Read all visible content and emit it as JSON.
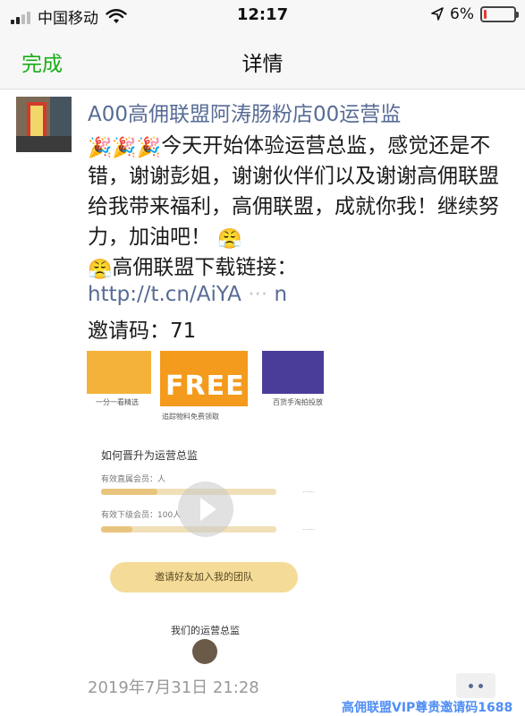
{
  "status_bar": {
    "carrier": "中国移动",
    "time": "12:17",
    "battery_percent": "6%",
    "battery_level": 0.06,
    "icons": [
      "signal-icon",
      "wifi-icon",
      "location-icon",
      "battery-icon"
    ]
  },
  "nav": {
    "done_label": "完成",
    "title": "详情"
  },
  "post": {
    "author": "A00高佣联盟阿涛肠粉店00运营监",
    "text_line1": "今天开始体验运营总监，感觉还是不错，谢谢彭姐，谢谢伙伴们以及谢谢高佣联盟给我带来福利，高佣联盟，成就你我！继续努力，加油吧！",
    "text_line2": "高佣联盟下载链接：",
    "emojis": [
      "party-popper",
      "party-popper",
      "party-popper",
      "strong-face",
      "strong-face"
    ],
    "link": "http://t.cn/AiYA",
    "link_tail": "n",
    "invite_label": "邀请码：",
    "invite_code": "71"
  },
  "video": {
    "banner_text": "FREE",
    "left_caption": "一分一看精选",
    "mid_caption": "追踪物料免费领取",
    "right_caption": "百货手淘拍投放",
    "heading": "如何晋升为运营总监",
    "row1_label": "有效直属会员：",
    "row1_value": "人",
    "row2_label": "有效下级会员：",
    "row2_value": "100人",
    "button_text": "邀请好友加入我的团队",
    "footer_text": "我们的运营总监",
    "progress_1": 0.32,
    "progress_2": 0.18
  },
  "timestamp": "2019年7月31日 21:28",
  "watermark": "高佣联盟VIP尊贵邀请码1688"
}
